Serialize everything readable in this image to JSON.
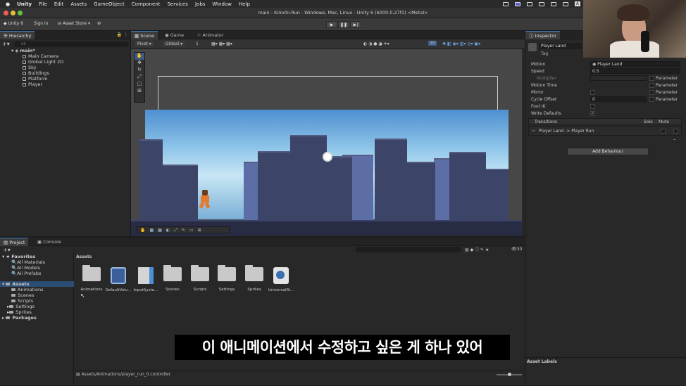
{
  "macbar": {
    "apple": "",
    "menus": [
      "Unity",
      "File",
      "Edit",
      "Assets",
      "GameObject",
      "Component",
      "Services",
      "Jobs",
      "Window",
      "Help"
    ]
  },
  "window": {
    "title": "main - Kimchi-Run - Windows, Mac, Linux - Unity 6 (6000.0.27f1) <Metal>"
  },
  "toolbar": {
    "account": "Unity 6",
    "sign_in": "Sign in",
    "asset_store": "Asset Store ▾"
  },
  "hierarchy": {
    "tab": "Hierarchy",
    "search_placeholder": "All",
    "scene": "main*",
    "items": [
      "Main Camera",
      "Global Light 2D",
      "Sky",
      "Buildings",
      "Platform",
      "Player"
    ]
  },
  "scene_tabs": [
    "Scene",
    "Game",
    "Animator"
  ],
  "scene_toolbar": {
    "pivot": "Pivot ▾",
    "global": "Global ▾",
    "grid": "1",
    "mode": "2D"
  },
  "inspector": {
    "tab": "Inspector",
    "name": "Player Land",
    "tag": "Tag",
    "props": [
      {
        "label": "Motion",
        "value": "Player Land"
      },
      {
        "label": "Speed",
        "value": "0.5"
      },
      {
        "label": "Multiplier",
        "value": ""
      },
      {
        "label": "Motion Time",
        "value": ""
      },
      {
        "label": "Mirror",
        "value": ""
      },
      {
        "label": "Cycle Offset",
        "value": "0"
      },
      {
        "label": "Foot IK",
        "value": ""
      },
      {
        "label": "Write Defaults",
        "value": "✓"
      }
    ],
    "param_label": "Parameter",
    "transitions_header": "Transitions",
    "solo": "Solo",
    "mute": "Mute",
    "transition": "Player Land -> Player Run",
    "add_behaviour": "Add Behaviour",
    "asset_labels": "Asset Labels"
  },
  "project": {
    "tabs": [
      "Project",
      "Console"
    ],
    "favorites": "Favorites",
    "fav_items": [
      "All Materials",
      "All Models",
      "All Prefabs"
    ],
    "assets_root": "Assets",
    "asset_folders": [
      "Animations",
      "Scenes",
      "Scripts",
      "Settings",
      "Sprites"
    ],
    "packages": "Packages",
    "breadcrumb": "Assets",
    "grid_items": [
      "Animations",
      "DefaultVolu...",
      "InputSyste...",
      "Scenes",
      "Scripts",
      "Settings",
      "Sprites",
      "UniversalRi..."
    ],
    "path": "Assets/Animations/player_run_0.controller",
    "count": "30"
  },
  "subtitle": "이 애니메이션에서 수정하고 싶은 게 하나 있어"
}
